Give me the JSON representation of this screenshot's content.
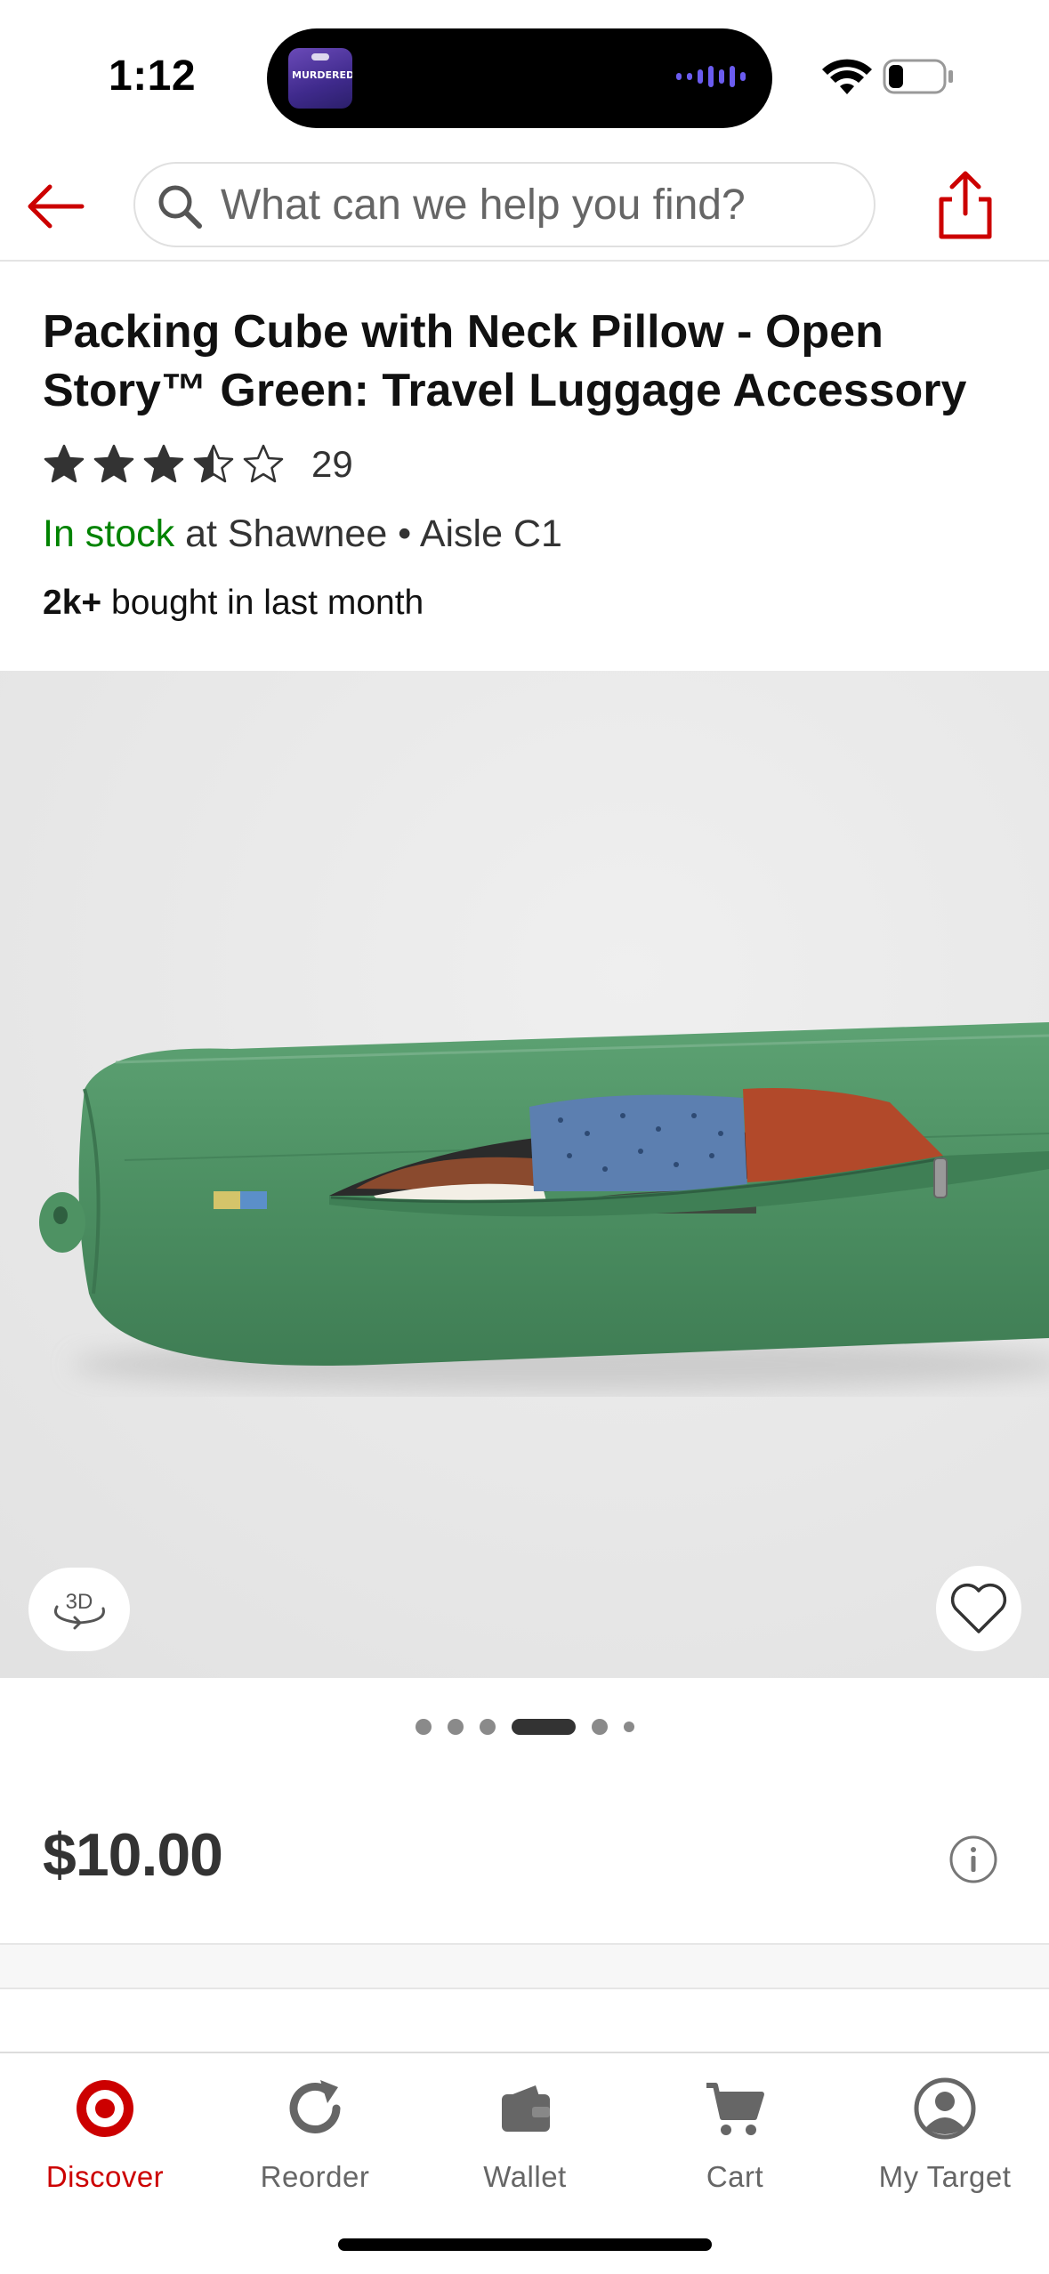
{
  "status_bar": {
    "time": "1:12",
    "island_art_text": "MURDERED:"
  },
  "header": {
    "search_placeholder": "What can we help you find?"
  },
  "product": {
    "title": "Packing Cube with Neck Pillow - Open Story™ Green: Travel Luggage Accessory",
    "rating_value": 3.5,
    "rating_max": 5,
    "rating_count": "29",
    "stock_status": "In stock",
    "stock_location": "at Shawnee • Aisle C1",
    "bought_count": "2k+",
    "bought_text": "bought in last month",
    "price": "$10.00",
    "btn_3d_label": "3D",
    "carousel": {
      "total": 6,
      "active_index": 3
    }
  },
  "bottom_nav": {
    "items": [
      {
        "label": "Discover",
        "icon": "target-logo-icon",
        "active": true
      },
      {
        "label": "Reorder",
        "icon": "reorder-icon",
        "active": false
      },
      {
        "label": "Wallet",
        "icon": "wallet-icon",
        "active": false
      },
      {
        "label": "Cart",
        "icon": "cart-icon",
        "active": false
      },
      {
        "label": "My Target",
        "icon": "account-icon",
        "active": false
      }
    ]
  },
  "colors": {
    "brand_red": "#cc0000",
    "stock_green": "#008300",
    "product_green": "#4e9263"
  }
}
